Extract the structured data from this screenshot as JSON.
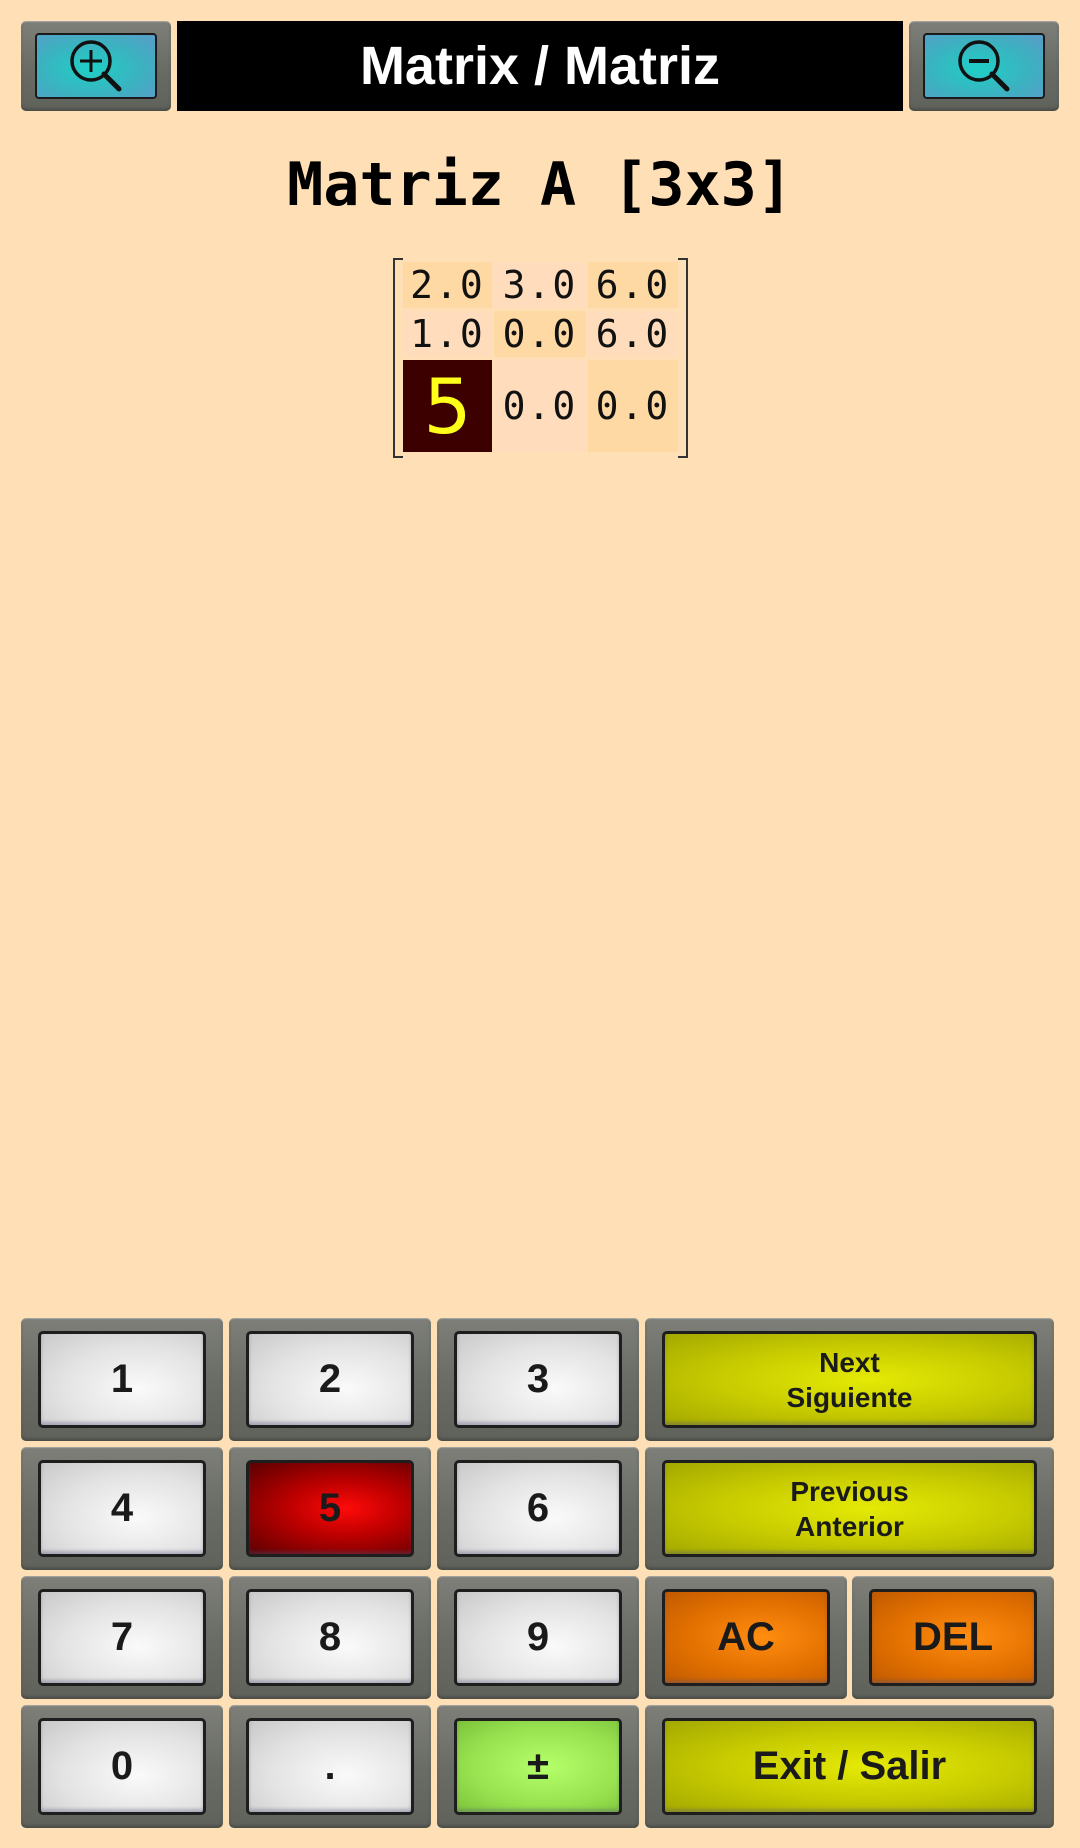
{
  "header": {
    "title": "Matrix / Matriz",
    "zoom_in_icon": "zoom-in-icon",
    "zoom_out_icon": "zoom-out-icon"
  },
  "matrix": {
    "heading": "Matriz A [3x3]",
    "rows": [
      [
        "2.0",
        "3.0",
        "6.0"
      ],
      [
        "1.0",
        "0.0",
        "6.0"
      ],
      [
        "5",
        "0.0",
        "0.0"
      ]
    ],
    "active_cell": {
      "row": 3,
      "col": 1,
      "value": "5"
    }
  },
  "keypad": {
    "keys": {
      "k1": "1",
      "k2": "2",
      "k3": "3",
      "k4": "4",
      "k5": "5",
      "k6": "6",
      "k7": "7",
      "k8": "8",
      "k9": "9",
      "k0": "0",
      "dot": ".",
      "sign": "±"
    },
    "next": {
      "line1": "Next",
      "line2": "Siguiente"
    },
    "previous": {
      "line1": "Previous",
      "line2": "Anterior"
    },
    "ac": "AC",
    "del": "DEL",
    "exit": "Exit / Salir",
    "pressed_key": "5"
  },
  "colors": {
    "background": "#ffdfb5",
    "title_bar": "#000000",
    "active_cell_bg": "#3d0000",
    "active_cell_text": "#ffff1a",
    "pressed_key": "#d00000",
    "nav_keys": "#c8cc00",
    "clear_keys": "#e27000",
    "sign_key": "#98e250",
    "zoom_buttons": "#3bb2c0"
  }
}
